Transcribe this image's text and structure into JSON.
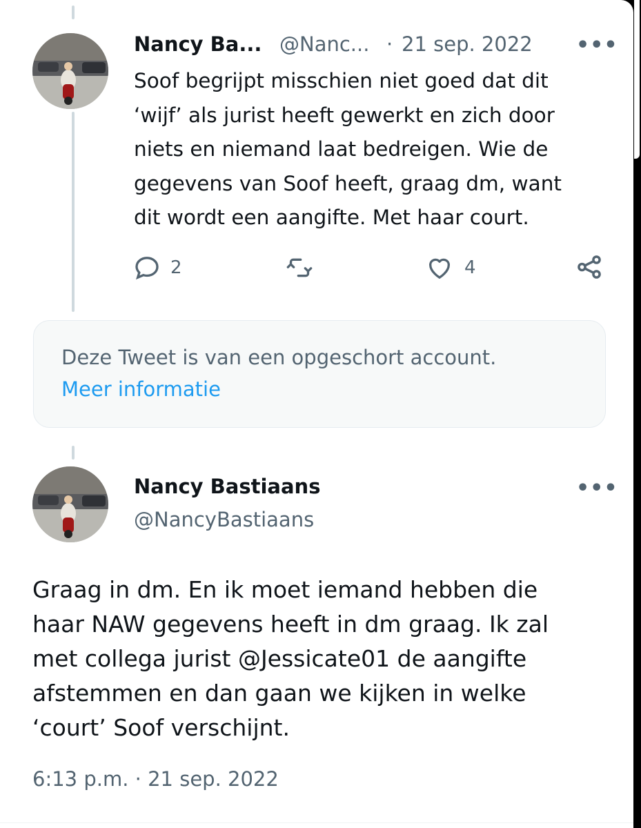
{
  "tweet1": {
    "display_name": "Nancy Ba...",
    "handle": "@Nanc...",
    "separator": "·",
    "date": "21 sep. 2022",
    "more": "•••",
    "text": "Soof begrijpt misschien niet goed dat dit\n‘wijf’ als jurist heeft gewerkt en zich door\nniets en niemand laat bedreigen. Wie de\ngegevens van Soof heeft, graag dm, want\ndit wordt een aangifte. Met haar court.",
    "actions": {
      "reply_icon": "speech-bubble-icon",
      "reply_count": "2",
      "retweet_icon": "retweet-icon",
      "like_icon": "heart-icon",
      "like_count": "4",
      "share_icon": "share-nodes-icon"
    }
  },
  "notice": {
    "text": "Deze Tweet is van een opgeschort account.",
    "link": "Meer informatie"
  },
  "tweet2": {
    "display_name": "Nancy Bastiaans",
    "handle": "@NancyBastiaans",
    "more": "•••",
    "text": "Graag in dm. En ik moet iemand hebben die\nhaar NAW gegevens heeft in dm graag. Ik zal\nmet collega jurist @Jessicate01 de aangifte\nafstemmen en dan gaan we kijken in welke\n‘court’ Soof verschijnt.",
    "timestamp": "6:13 p.m. · 21 sep. 2022"
  },
  "colors": {
    "text": "#0f1419",
    "muted": "#536471",
    "link": "#1d9bf0",
    "notice_bg": "#f7f9f9",
    "thread_line": "#cfd9de"
  }
}
